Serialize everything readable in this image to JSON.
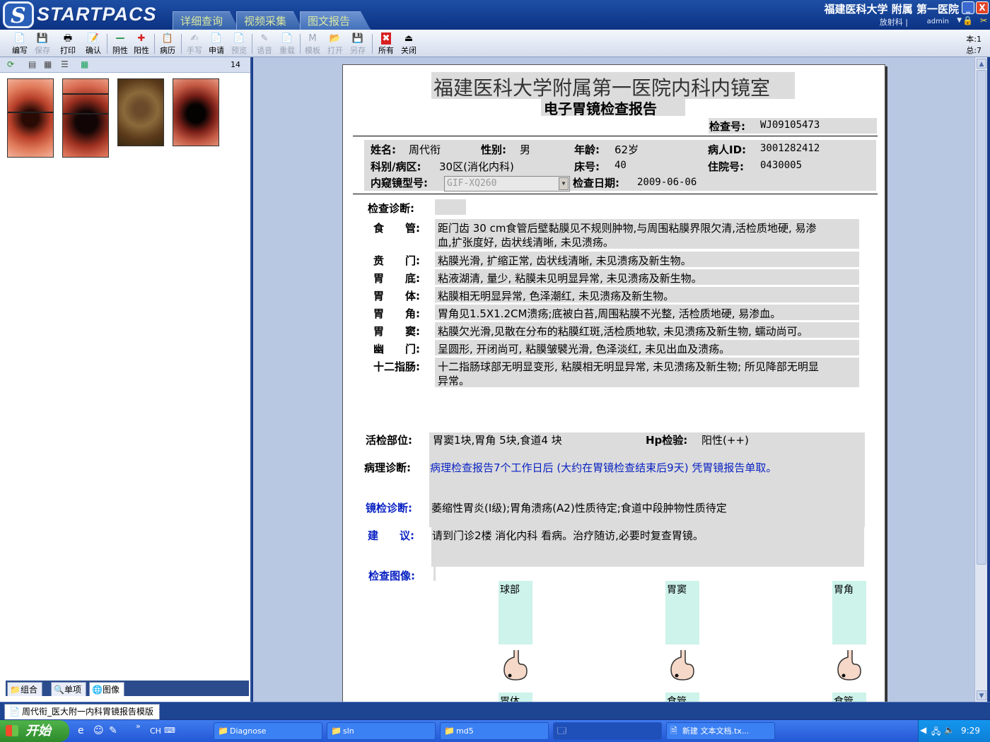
{
  "app": {
    "logo_mark": "S",
    "logo_text": "STARTPACS",
    "nav_tabs": [
      "详细查询",
      "视频采集",
      "图文报告"
    ],
    "hospital": "福建医科大学 附属 第一医院",
    "dept": "放射科 |",
    "user": "admin",
    "min_symbol": "_",
    "close_symbol": "X"
  },
  "toolbar": {
    "buttons": [
      {
        "label": "编写",
        "icon": "📄"
      },
      {
        "label": "保存",
        "icon": "💾"
      },
      {
        "label": "打印",
        "icon": "🖶"
      },
      {
        "label": "确认",
        "icon": "📝"
      },
      {
        "label": "阴性",
        "icon": "—"
      },
      {
        "label": "阳性",
        "icon": "✚"
      },
      {
        "label": "病历",
        "icon": "📋"
      },
      {
        "label": "手写",
        "icon": "✍"
      },
      {
        "label": "申请",
        "icon": "📄"
      },
      {
        "label": "预览",
        "icon": "📄"
      },
      {
        "label": "语音",
        "icon": "✎"
      },
      {
        "label": "重载",
        "icon": "📄"
      },
      {
        "label": "模板",
        "icon": "M"
      },
      {
        "label": "打开",
        "icon": "📂"
      },
      {
        "label": "另存",
        "icon": "💾"
      },
      {
        "label": "所有",
        "icon": "✖"
      },
      {
        "label": "关闭",
        "icon": "⏏"
      }
    ],
    "page_current": "本:1",
    "page_total": "总:7"
  },
  "left_panel": {
    "image_count": "14",
    "tabs": [
      "组合",
      "单项",
      "图像"
    ]
  },
  "report": {
    "title": "福建医科大学附属第一医院内科内镜室",
    "subtitle": "电子胃镜检查报告",
    "exam_no_label": "检查号:",
    "exam_no": "WJ09105473",
    "name_label": "姓名:",
    "name": "周代衔",
    "sex_label": "性别:",
    "sex": "男",
    "age_label": "年龄:",
    "age": "62岁",
    "pid_label": "病人ID:",
    "pid": "3001282412",
    "ward_label": "科别/病区:",
    "ward": "30区(消化内科)",
    "bed_label": "床号:",
    "bed": "40",
    "inpatient_label": "住院号:",
    "inpatient_no": "0430005",
    "scope_label": "内窥镜型号:",
    "scope_model": "GIF-XQ260",
    "date_label": "检查日期:",
    "date": "2009-06-06",
    "diag_label": "检查诊断:",
    "findings": [
      {
        "label": "食　　管:",
        "lines": [
          "距门齿 30 cm食管后壁黏膜见不规则肿物,与周围粘膜界限欠清,活检质地硬, 易渗",
          "血,扩张度好, 齿状线清晰, 未见溃疡。"
        ]
      },
      {
        "label": "贲　　门:",
        "lines": [
          "粘膜光滑, 扩缩正常, 齿状线清晰, 未见溃疡及新生物。"
        ]
      },
      {
        "label": "胃　　底:",
        "lines": [
          "粘液湖清, 量少, 粘膜未见明显异常, 未见溃疡及新生物。"
        ]
      },
      {
        "label": "胃　　体:",
        "lines": [
          "粘膜相无明显异常, 色泽潮红, 未见溃疡及新生物。"
        ]
      },
      {
        "label": "胃　　角:",
        "lines": [
          "胃角见1.5X1.2CM溃疡;底被白苔,周围粘膜不光整, 活检质地硬, 易渗血。"
        ]
      },
      {
        "label": "胃　　窦:",
        "lines": [
          "粘膜欠光滑,见散在分布的粘膜红斑,活检质地软, 未见溃疡及新生物, 蠕动尚可。"
        ]
      },
      {
        "label": "幽　　门:",
        "lines": [
          "呈圆形, 开闭尚可, 粘膜皱襞光滑, 色泽淡红, 未见出血及溃疡。"
        ]
      },
      {
        "label": "十二指肠:",
        "lines": [
          "十二指肠球部无明显变形, 粘膜相无明显异常, 未见溃疡及新生物; 所见降部无明显",
          "异常。"
        ]
      }
    ],
    "biopsy_label": "活检部位:",
    "biopsy": "胃窦1块,胃角 5块,食道4 块",
    "hp_label": "Hp检验:",
    "hp": "阳性(++)",
    "patho_label": "病理诊断:",
    "patho": "病理检查报告7个工作日后 (大约在胃镜检查结束后9天) 凭胃镜报告单取。",
    "endo_label": "镜检诊断:",
    "endo": "萎缩性胃炎(I级);胃角溃疡(A2)性质待定;食道中段肿物性质待定",
    "advice_label": "建　　议:",
    "advice": "请到门诊2楼 消化内科 看病。治疗随访,必要时复查胃镜。",
    "images_label": "检查图像:",
    "image_slots": [
      "球部",
      "胃窦",
      "胃角"
    ],
    "image_slots_2": [
      "胃体",
      "食管",
      "食管"
    ]
  },
  "doc_tab": "周代衔_医大附一内科胃镜报告模版",
  "taskbar": {
    "start": "开始",
    "lang": "CH",
    "tasks": [
      "Diagnose",
      "sln",
      "md5",
      "",
      "新建 文本文档.tx..."
    ],
    "clock": "9:29"
  }
}
